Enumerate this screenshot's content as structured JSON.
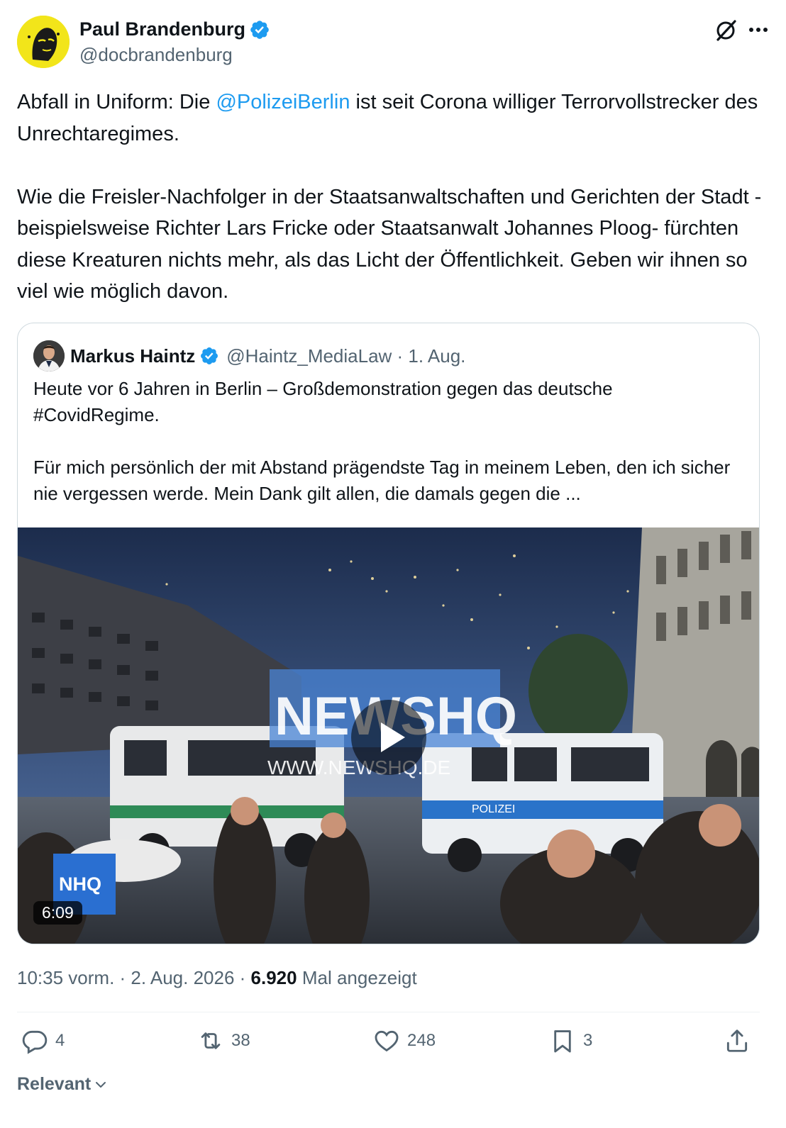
{
  "author": {
    "display_name": "Paul Brandenburg",
    "handle": "@docbrandenburg",
    "verified": true,
    "avatar_bg": "#f2e51a"
  },
  "tweet": {
    "text_part1": "Abfall in Uniform: Die ",
    "mention": "@PolizeiBerlin",
    "text_part2": " ist seit Corona williger Terrorvollstrecker des Unrechtaregimes.",
    "paragraph2": "Wie die Freisler-Nachfolger in der Staatsanwaltschaften und Gerichten der Stadt - beispielsweise Richter Lars Fricke oder Staatsanwalt Johannes Ploog- fürchten diese Kreaturen nichts mehr, als das Licht der Öffentlichkeit. Geben wir ihnen so viel wie möglich davon.",
    "mention_color": "#1d9bf0"
  },
  "quote": {
    "display_name": "Markus Haintz",
    "handle_date": "@Haintz_MediaLaw · 1. Aug.",
    "verified": true,
    "paragraph1": "Heute vor 6 Jahren in Berlin – Großdemonstration gegen das deutsche #CovidRegime.",
    "paragraph2": "Für mich persönlich der mit Abstand prägendste Tag in meinem Leben, den ich sicher nie vergessen werde. Mein Dank gilt allen, die damals gegen die ...",
    "video": {
      "duration": "6:09",
      "watermark": "NEWSHQ",
      "watermark_url": "WWW.NEWSHQ.DE",
      "corner_logo": "NHQ",
      "van_label": "POLIZEI"
    }
  },
  "meta": {
    "time_date": "10:35 vorm. · 2. Aug. 2026 · ",
    "views_count": "6.920",
    "views_label": " Mal angezeigt"
  },
  "actions": {
    "replies": "4",
    "reposts": "38",
    "likes": "248",
    "bookmarks": "3"
  },
  "sort": {
    "label": "Relevant"
  },
  "colors": {
    "verified_blue": "#1d9bf0",
    "text_secondary": "#536471",
    "text_primary": "#0f1419"
  }
}
